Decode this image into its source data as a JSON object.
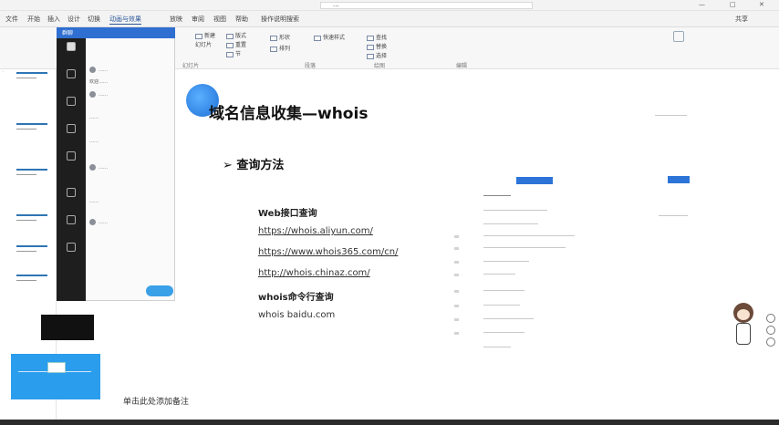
{
  "titlebar": {
    "title": "...",
    "buttons": [
      "—",
      "□",
      "✕"
    ]
  },
  "tabs": [
    "文件",
    "开始",
    "插入",
    "设计",
    "切换",
    "动画与效果",
    "放映",
    "审阅",
    "视图",
    "帮助",
    "操作说明搜索",
    "共享"
  ],
  "ribbon": {
    "groups": [
      "幻灯片",
      "段落",
      "绘图",
      "编辑"
    ],
    "items": [
      "新建",
      "幻灯片",
      "版式",
      "重置",
      "节",
      "形状",
      "排列",
      "快速样式",
      "查找",
      "替换",
      "选择"
    ]
  },
  "chat": {
    "header": "群聊",
    "messages": [
      "……",
      "欢迎……",
      "……",
      "……",
      "……",
      "……",
      "……",
      "……"
    ]
  },
  "slide": {
    "title": "域名信息收集—whois",
    "bullet": "查询方法",
    "lines": [
      {
        "text": "Web接口查询",
        "style": "bold"
      },
      {
        "text": "https://whois.aliyun.com/",
        "style": "link"
      },
      {
        "text": "https://www.whois365.com/cn/",
        "style": "link"
      },
      {
        "text": "http://whois.chinaz.com/",
        "style": "link"
      },
      {
        "text": "whois命令行查询",
        "style": "bold"
      },
      {
        "text": "whois baidu.com",
        "style": "plain"
      }
    ]
  },
  "footer_note": "单击此处添加备注"
}
